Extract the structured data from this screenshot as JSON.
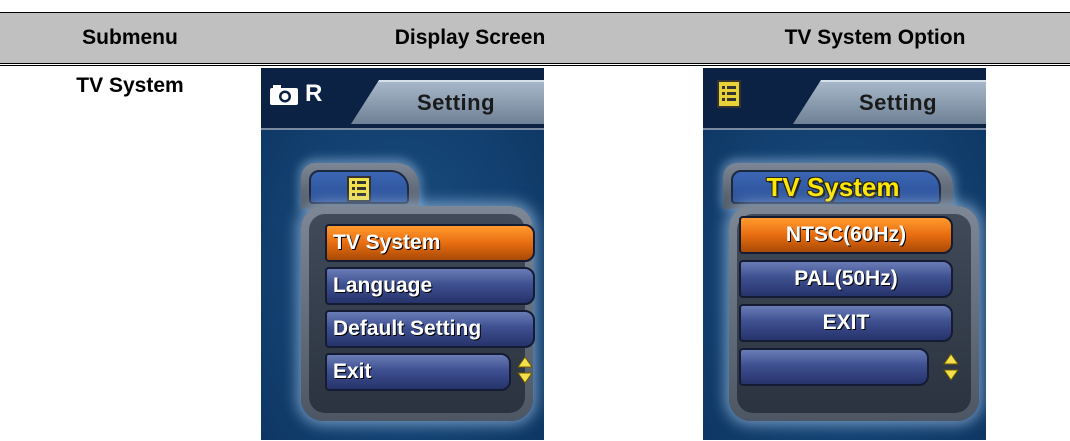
{
  "table": {
    "headers": [
      "Submenu",
      "Display Screen",
      "TV System Option"
    ],
    "row": {
      "submenu": "TV System"
    }
  },
  "screen1": {
    "tab_label": "Setting",
    "mode_letter": "R",
    "menu_items": [
      "TV System",
      "Language",
      "Default Setting",
      "Exit"
    ],
    "selected_index": 0
  },
  "screen2": {
    "tab_label": "Setting",
    "folder_title": "TV System",
    "menu_items": [
      "NTSC(60Hz)",
      "PAL(50Hz)",
      "EXIT",
      ""
    ],
    "selected_index": 0
  },
  "colors": {
    "header_bg": "#c0c0c0",
    "screen_bg": "#12406f",
    "selected_item": "#e86d10",
    "menu_item": "#3f5091",
    "title_yellow": "#ffe600"
  },
  "icons": [
    "camera-icon",
    "list-icon",
    "scroll-arrows-icon"
  ]
}
